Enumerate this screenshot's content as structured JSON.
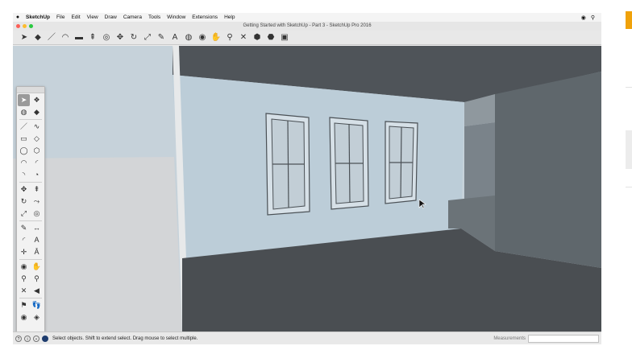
{
  "menubar": {
    "app_name": "SketchUp",
    "items": [
      "File",
      "Edit",
      "View",
      "Draw",
      "Camera",
      "Tools",
      "Window",
      "Extensions",
      "Help"
    ],
    "right_icons": [
      "record-icon",
      "spotlight-search-icon"
    ]
  },
  "window": {
    "title": "Getting Started with SketchUp - Part 3 - SketchUp Pro 2016"
  },
  "toolbar": {
    "tools": [
      {
        "name": "select",
        "glyph": "➤"
      },
      {
        "name": "eraser",
        "glyph": "◆"
      },
      {
        "name": "line",
        "glyph": "／"
      },
      {
        "name": "arc",
        "glyph": "◠"
      },
      {
        "name": "rectangle",
        "glyph": "▬"
      },
      {
        "name": "push-pull",
        "glyph": "⇞"
      },
      {
        "name": "offset",
        "glyph": "◎"
      },
      {
        "name": "move",
        "glyph": "✥"
      },
      {
        "name": "rotate",
        "glyph": "↻"
      },
      {
        "name": "scale",
        "glyph": "⤢"
      },
      {
        "name": "tape-measure",
        "glyph": "✎"
      },
      {
        "name": "text",
        "glyph": "A"
      },
      {
        "name": "paint-bucket",
        "glyph": "◍"
      },
      {
        "name": "orbit",
        "glyph": "◉"
      },
      {
        "name": "pan",
        "glyph": "✋"
      },
      {
        "name": "zoom",
        "glyph": "⚲"
      },
      {
        "name": "zoom-extents",
        "glyph": "✕"
      },
      {
        "name": "warehouse",
        "glyph": "⬢"
      },
      {
        "name": "extension-warehouse",
        "glyph": "⬣"
      },
      {
        "name": "layout",
        "glyph": "▣"
      }
    ]
  },
  "palette": {
    "tools": [
      {
        "name": "select",
        "glyph": "➤",
        "selected": true
      },
      {
        "name": "make-component",
        "glyph": "❖"
      },
      {
        "name": "paint-bucket",
        "glyph": "◍"
      },
      {
        "name": "eraser",
        "glyph": "◆"
      },
      {
        "sep": true
      },
      {
        "name": "line",
        "glyph": "／"
      },
      {
        "name": "freehand",
        "glyph": "∿"
      },
      {
        "name": "rectangle",
        "glyph": "▭"
      },
      {
        "name": "rotated-rectangle",
        "glyph": "◇"
      },
      {
        "name": "circle",
        "glyph": "◯"
      },
      {
        "name": "polygon",
        "glyph": "⬡"
      },
      {
        "name": "arc",
        "glyph": "◠"
      },
      {
        "name": "two-point-arc",
        "glyph": "◜"
      },
      {
        "name": "three-point-arc",
        "glyph": "◝"
      },
      {
        "name": "pie",
        "glyph": "◔"
      },
      {
        "sep": true
      },
      {
        "name": "move",
        "glyph": "✥"
      },
      {
        "name": "push-pull",
        "glyph": "⇞"
      },
      {
        "name": "rotate",
        "glyph": "↻"
      },
      {
        "name": "follow-me",
        "glyph": "⤳"
      },
      {
        "name": "scale",
        "glyph": "⤢"
      },
      {
        "name": "offset",
        "glyph": "◎"
      },
      {
        "sep": true
      },
      {
        "name": "tape-measure",
        "glyph": "✎"
      },
      {
        "name": "dimension",
        "glyph": "↔"
      },
      {
        "name": "protractor",
        "glyph": "◜"
      },
      {
        "name": "text",
        "glyph": "A"
      },
      {
        "name": "axes",
        "glyph": "✛"
      },
      {
        "name": "3d-text",
        "glyph": "Ā"
      },
      {
        "sep": true
      },
      {
        "name": "orbit",
        "glyph": "◉"
      },
      {
        "name": "pan",
        "glyph": "✋"
      },
      {
        "name": "zoom",
        "glyph": "⚲"
      },
      {
        "name": "zoom-window",
        "glyph": "⚲"
      },
      {
        "name": "zoom-extents",
        "glyph": "✕"
      },
      {
        "name": "previous-view",
        "glyph": "◀"
      },
      {
        "sep": true
      },
      {
        "name": "position-camera",
        "glyph": "⚑"
      },
      {
        "name": "walk",
        "glyph": "👣"
      },
      {
        "name": "look-around",
        "glyph": "◉"
      },
      {
        "name": "section-plane",
        "glyph": "◈"
      }
    ]
  },
  "status": {
    "icons": [
      "geo-location-icon",
      "credits-icon",
      "user-icon",
      "help-icon"
    ],
    "message": "Select objects. Shift to extend select. Drag mouse to select multiple.",
    "measurements_label": "Measurements",
    "measurements_value": ""
  },
  "colors": {
    "side_accent": "#f0a20a",
    "ceiling": "#4f5459",
    "back_wall": "#bccdd8",
    "right_wall": "#5f676c",
    "floor": "#4a4e52",
    "ground": "#d3d5d7"
  }
}
